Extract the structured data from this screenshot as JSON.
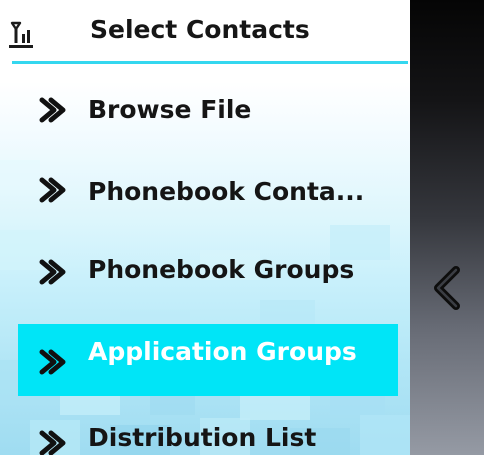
{
  "header": {
    "title": "Select Contacts",
    "icon": "antenna-signal-icon"
  },
  "menu": {
    "items": [
      {
        "label": "Browse File",
        "icon": "chevron-right-icon",
        "selected": false
      },
      {
        "label": "Phonebook Conta...",
        "icon": "chevron-right-icon",
        "selected": false
      },
      {
        "label": "Phonebook Groups",
        "icon": "chevron-right-icon",
        "selected": false
      },
      {
        "label": "Application Groups",
        "icon": "chevron-right-icon",
        "selected": true
      },
      {
        "label": "Distribution List",
        "icon": "chevron-right-icon",
        "selected": false
      }
    ]
  },
  "side_panel": {
    "back_icon": "chevron-left-icon"
  },
  "colors": {
    "accent": "#00e5f7",
    "header_rule": "#34d7ef",
    "text": "#151515",
    "selected_text": "#ffffff",
    "side_panel_top": "#050505",
    "side_panel_bottom": "#959aa4"
  }
}
